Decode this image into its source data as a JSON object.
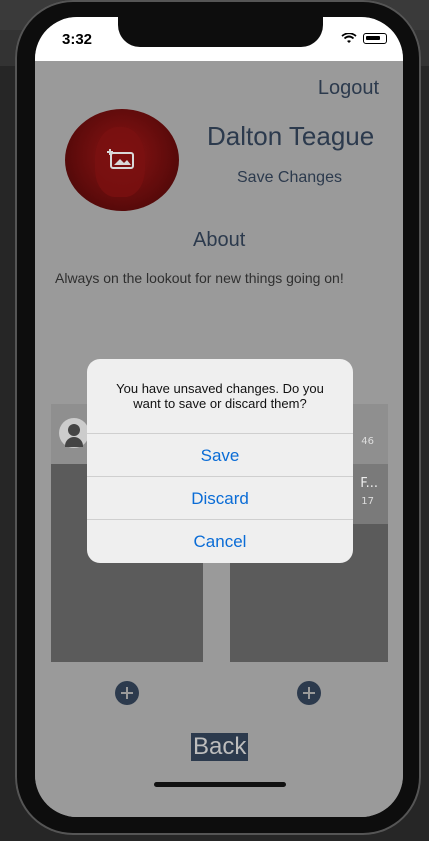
{
  "status_bar": {
    "time": "3:32"
  },
  "header": {
    "logout": "Logout"
  },
  "profile": {
    "name": "Dalton Teague",
    "save_changes": "Save Changes",
    "about_title": "About",
    "bio": "Always on the lookout for new things going on!"
  },
  "cards": {
    "right_count_1": "46",
    "right_title": "F...",
    "right_count_2": "17"
  },
  "alert": {
    "message": "You have unsaved changes. Do you want to save or discard them?",
    "buttons": [
      "Save",
      "Discard",
      "Cancel"
    ]
  },
  "footer": {
    "back": "Back"
  },
  "colors": {
    "accent": "#2c3a4d",
    "alert_button": "#0a6cd6"
  }
}
